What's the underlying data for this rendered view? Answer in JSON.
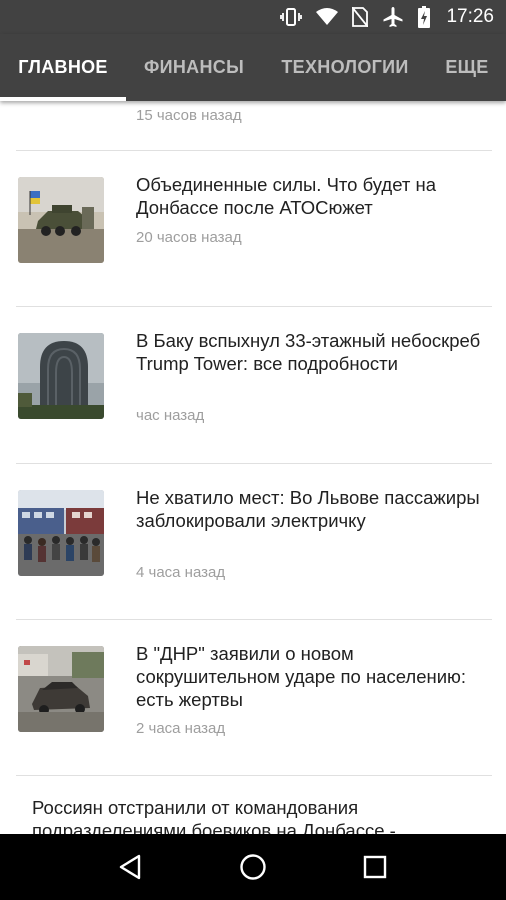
{
  "status_bar": {
    "time": "17:26",
    "icons": [
      "vibrate-icon",
      "wifi-icon",
      "no-sim-icon",
      "airplane-icon",
      "battery-charging-icon"
    ]
  },
  "tabs": [
    {
      "label": "ГЛАВНОЕ",
      "active": true
    },
    {
      "label": "ФИНАНСЫ",
      "active": false
    },
    {
      "label": "ТЕХНОЛОГИИ",
      "active": false
    },
    {
      "label": "ЕЩЕ",
      "active": false
    }
  ],
  "feed": {
    "partial_top_time": "15 часов назад",
    "items": [
      {
        "title": "Объединенные силы. Что будет на Донбассе после АТОСюжет",
        "time": "20 часов назад",
        "thumb": "military-vehicle-photo"
      },
      {
        "title": "В Баку вспыхнул 33-этажный небоскреб Trump Tower: все подробности",
        "time": "час назад",
        "thumb": "tower-photo"
      },
      {
        "title": "Не хватило мест: Во Львове пассажиры заблокировали электричку",
        "time": "4 часа назад",
        "thumb": "train-crowd-photo"
      },
      {
        "title": "В \"ДНР\" заявили о новом сокрушительном ударе по населению: есть жертвы",
        "time": "2 часа назад",
        "thumb": "destroyed-car-photo"
      }
    ],
    "text_only_item": {
      "title": "Россиян отстранили от командования подразделениями боевиков на Донбассе -"
    }
  },
  "navbar": {
    "icons": [
      "back-icon",
      "home-icon",
      "recents-icon"
    ]
  }
}
